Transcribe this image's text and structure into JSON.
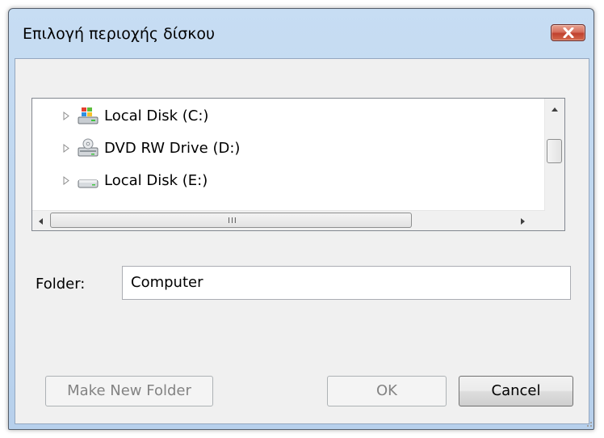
{
  "window": {
    "title": "Επιλογή περιοχής δίσκου"
  },
  "tree": {
    "items": [
      {
        "label": "Local Disk (C:)",
        "icon": "windows-drive-icon"
      },
      {
        "label": "DVD RW Drive (D:)",
        "icon": "dvd-drive-icon"
      },
      {
        "label": "Local Disk (E:)",
        "icon": "hard-drive-icon"
      }
    ],
    "hscroll_grip": "III"
  },
  "folder": {
    "label": "Folder:",
    "value": "Computer"
  },
  "buttons": {
    "make_new_folder": "Make New Folder",
    "ok": "OK",
    "cancel": "Cancel"
  }
}
